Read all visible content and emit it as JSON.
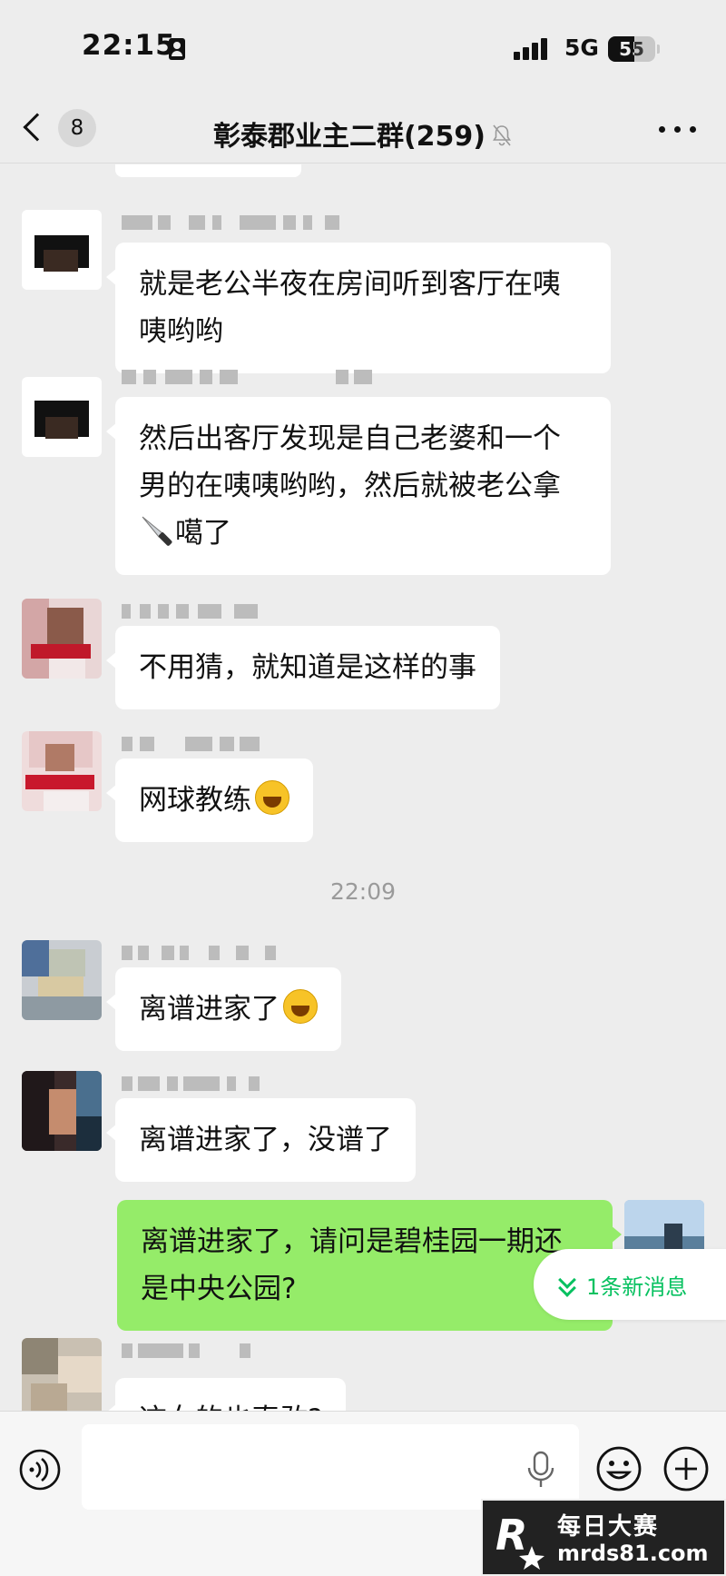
{
  "status_bar": {
    "time": "22:15",
    "network": "5G",
    "battery": "55",
    "battery_level": 0.55,
    "signal_bars": 4
  },
  "nav": {
    "back_count": "8",
    "title": "彰泰郡业主二群(259)",
    "muted": true
  },
  "messages": [
    {
      "type": "text",
      "side": "left",
      "text": "就是老公半夜在房间听到客厅在咦咦哟哟"
    },
    {
      "type": "text",
      "side": "left",
      "text": "然后出客厅发现是自己老婆和一个男的在咦咦哟哟，然后就被老公拿",
      "text_after": "噶了",
      "inline_icon": "knife-emoji"
    },
    {
      "type": "text",
      "side": "left",
      "text": "不用猜，就知道是这样的事"
    },
    {
      "type": "text",
      "side": "left",
      "text": "网球教练",
      "inline_icon": "grinning-emoji"
    },
    {
      "type": "timestamp",
      "text": "22:09"
    },
    {
      "type": "text",
      "side": "left",
      "text": "离谱进家了",
      "inline_icon": "laughing-crying-emoji"
    },
    {
      "type": "text",
      "side": "left",
      "text": "离谱进家了，没谱了"
    },
    {
      "type": "text",
      "side": "right",
      "text": "离谱进家了，请问是碧桂园一期还是中央公园?"
    },
    {
      "type": "text",
      "side": "left",
      "text": "这女的也真敢?"
    }
  ],
  "new_message_pill": {
    "label": "1条新消息"
  },
  "input": {
    "value": "",
    "placeholder": ""
  },
  "watermark": {
    "title": "每日大赛",
    "url": "mrds81.com"
  },
  "colors": {
    "background": "#ededed",
    "my_bubble": "#95ec69",
    "accent": "#07c160"
  }
}
